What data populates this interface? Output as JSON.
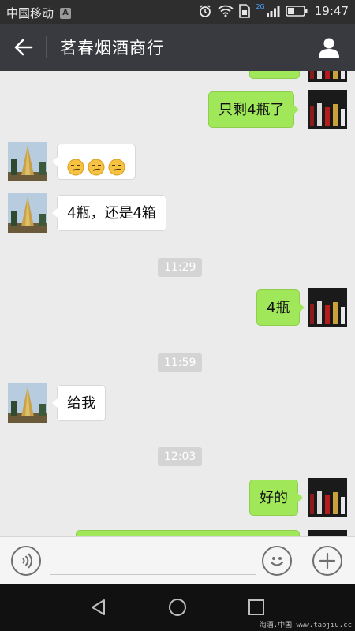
{
  "status_bar": {
    "carrier": "中国移动",
    "carrier_badge": "A",
    "network": "2G",
    "time": "19:47"
  },
  "header": {
    "title": "茗春烟酒商行"
  },
  "messages": [
    {
      "side": "me",
      "type": "text",
      "text": "只剩4瓶了"
    },
    {
      "side": "them",
      "type": "emoji",
      "text": "",
      "emoji_count": 3
    },
    {
      "side": "them",
      "type": "text",
      "text": "4瓶，还是4箱"
    },
    {
      "type": "timestamp",
      "text": "11:29"
    },
    {
      "side": "me",
      "type": "text",
      "text": "4瓶"
    },
    {
      "type": "timestamp",
      "text": "11:59"
    },
    {
      "side": "them",
      "type": "text",
      "text": "给我"
    },
    {
      "type": "timestamp",
      "text": "12:03"
    },
    {
      "side": "me",
      "type": "text",
      "text": "好的"
    }
  ],
  "input_bar": {
    "placeholder": ""
  },
  "watermark": "淘酒.中国 www.taojiu.cc",
  "colors": {
    "header_bg": "#393a3f",
    "my_bubble": "#a0e75a",
    "their_bubble": "#ffffff",
    "chat_bg": "#ebebeb"
  },
  "icons": {
    "back": "arrow-left-icon",
    "profile": "person-icon",
    "voice": "voice-icon",
    "emoji": "smiley-icon",
    "plus": "plus-icon"
  }
}
